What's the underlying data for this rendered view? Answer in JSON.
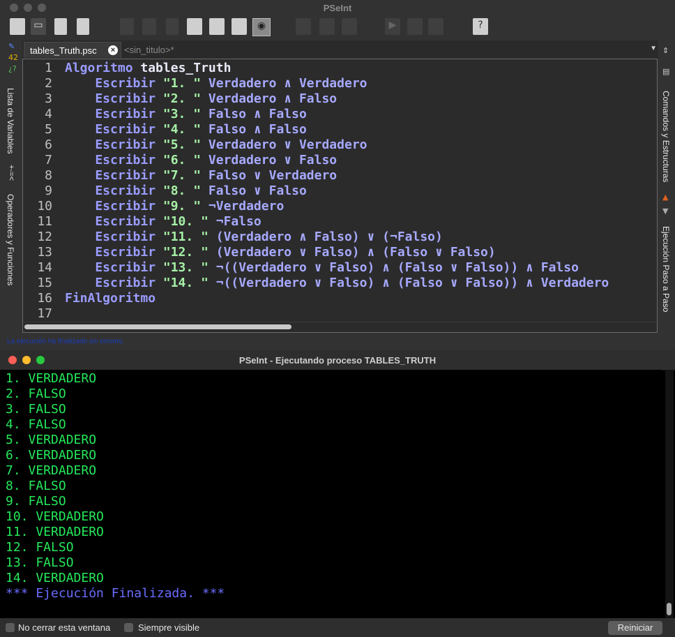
{
  "ide": {
    "title": "PSeInt",
    "tabs": {
      "active": "tables_Truth.psc",
      "inactive": "<sin_titulo>*"
    },
    "left_panel": {
      "variables_label": "Lista de Variables",
      "operators_label": "Operadores y Funciones",
      "operators_symbol": "+-=<"
    },
    "right_panel": {
      "commands_label": "Comandos y Estructuras",
      "stepper_label": "Ejecución Paso a Paso"
    },
    "status_message": "La ejecución ha finalizado sin errores.",
    "code": {
      "line_numbers": [
        "1",
        "2",
        "3",
        "4",
        "5",
        "6",
        "7",
        "8",
        "9",
        "10",
        "11",
        "12",
        "13",
        "14",
        "15",
        "16",
        "17"
      ],
      "lines": [
        {
          "kw": "Algoritmo",
          "id": " tables_Truth",
          "str": "",
          "ex": ""
        },
        {
          "kw": "    Escribir",
          "id": "",
          "str": " \"1. \"",
          "ex": " Verdadero ∧ Verdadero"
        },
        {
          "kw": "    Escribir",
          "id": "",
          "str": " \"2. \"",
          "ex": " Verdadero ∧ Falso"
        },
        {
          "kw": "    Escribir",
          "id": "",
          "str": " \"3. \"",
          "ex": " Falso ∧ Falso"
        },
        {
          "kw": "    Escribir",
          "id": "",
          "str": " \"4. \"",
          "ex": " Falso ∧ Falso"
        },
        {
          "kw": "    Escribir",
          "id": "",
          "str": " \"5. \"",
          "ex": " Verdadero ∨ Verdadero"
        },
        {
          "kw": "    Escribir",
          "id": "",
          "str": " \"6. \"",
          "ex": " Verdadero ∨ Falso"
        },
        {
          "kw": "    Escribir",
          "id": "",
          "str": " \"7. \"",
          "ex": " Falso ∨ Verdadero"
        },
        {
          "kw": "    Escribir",
          "id": "",
          "str": " \"8. \"",
          "ex": " Falso ∨ Falso"
        },
        {
          "kw": "    Escribir",
          "id": "",
          "str": " \"9. \"",
          "ex": " ¬Verdadero"
        },
        {
          "kw": "    Escribir",
          "id": "",
          "str": " \"10. \"",
          "ex": " ¬Falso"
        },
        {
          "kw": "    Escribir",
          "id": "",
          "str": " \"11. \"",
          "ex": " (Verdadero ∧ Falso) ∨ (¬Falso)"
        },
        {
          "kw": "    Escribir",
          "id": "",
          "str": " \"12. \"",
          "ex": " (Verdadero ∨ Falso) ∧ (Falso ∨ Falso)"
        },
        {
          "kw": "    Escribir",
          "id": "",
          "str": " \"13. \"",
          "ex": " ¬((Verdadero ∨ Falso) ∧ (Falso ∨ Falso)) ∧ Falso"
        },
        {
          "kw": "    Escribir",
          "id": "",
          "str": " \"14. \"",
          "ex": " ¬((Verdadero ∨ Falso) ∧ (Falso ∨ Falso)) ∧ Verdadero"
        },
        {
          "kw": "FinAlgoritmo",
          "id": "",
          "str": "",
          "ex": ""
        },
        {
          "kw": "",
          "id": "",
          "str": "",
          "ex": ""
        }
      ]
    }
  },
  "run_window": {
    "title": "PSeInt - Ejecutando proceso TABLES_TRUTH",
    "output": [
      "1. VERDADERO",
      "2. FALSO",
      "3. FALSO",
      "4. FALSO",
      "5. VERDADERO",
      "6. VERDADERO",
      "7. VERDADERO",
      "8. FALSO",
      "9. FALSO",
      "10. VERDADERO",
      "11. VERDADERO",
      "12. FALSO",
      "13. FALSO",
      "14. VERDADERO"
    ],
    "finished_message": "*** Ejecución Finalizada. ***",
    "keep_open_label": "No cerrar esta ventana",
    "always_visible_label": "Siempre visible",
    "restart_label": "Reiniciar"
  },
  "colors": {
    "traffic_close": "#ff5f57",
    "traffic_min": "#febc2e",
    "traffic_max": "#28c840",
    "console_text": "#25e85a",
    "keyword": "#9a9cff"
  }
}
